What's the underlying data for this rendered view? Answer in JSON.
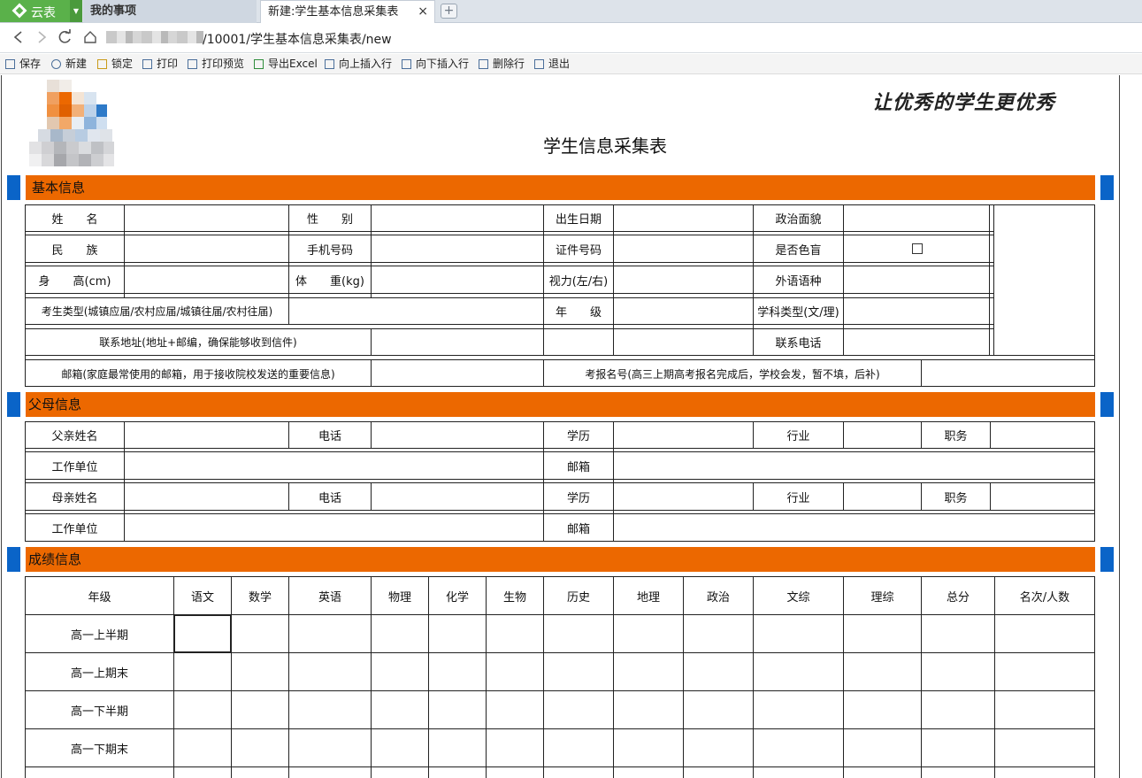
{
  "tabs": {
    "app_label": "云表",
    "tab1_label": "我的事项",
    "tab2_label": "新建:学生基本信息采集表",
    "close_glyph": "×",
    "new_tab_glyph": "+"
  },
  "address": {
    "url_visible": "/10001/学生基本信息采集表/new"
  },
  "toolbar": {
    "items": [
      {
        "label": "保存",
        "icon": "save-icon"
      },
      {
        "label": "新建",
        "icon": "new-icon"
      },
      {
        "label": "锁定",
        "icon": "lock-icon"
      },
      {
        "label": "打印",
        "icon": "print-icon"
      },
      {
        "label": "打印预览",
        "icon": "print-preview-icon"
      },
      {
        "label": "导出Excel",
        "icon": "excel-icon"
      },
      {
        "label": "向上插入行",
        "icon": "insert-row-above-icon"
      },
      {
        "label": "向下插入行",
        "icon": "insert-row-below-icon"
      },
      {
        "label": "删除行",
        "icon": "delete-row-icon"
      },
      {
        "label": "退出",
        "icon": "exit-icon"
      }
    ]
  },
  "form": {
    "slogan": "让优秀的学生更优秀",
    "title": "学生信息采集表",
    "section_basic": "基本信息",
    "section_parents": "父母信息",
    "section_scores": "成绩信息",
    "basic": {
      "name": "姓　　名",
      "gender": "性　　别",
      "birth": "出生日期",
      "politics": "政治面貌",
      "ethnic": "民　　族",
      "phone": "手机号码",
      "id_no": "证件号码",
      "colorblind": "是否色盲",
      "height": "身　　高(cm)",
      "weight": "体　　重(kg)",
      "vision": "视力(左/右)",
      "foreign_lang": "外语语种",
      "exam_type": "考生类型(城镇应届/农村应届/城镇往届/农村往届)",
      "grade": "年　　级",
      "subject_type": "学科类型(文/理)",
      "address": "联系地址(地址+邮编，确保能够收到信件)",
      "contact_phone": "联系电话",
      "email": "邮箱(家庭最常使用的邮箱，用于接收院校发送的重要信息)",
      "exam_no": "考报名号(高三上期高考报名完成后，学校会发，暂不填，后补)"
    },
    "parents": {
      "father_name": "父亲姓名",
      "mother_name": "母亲姓名",
      "phone": "电话",
      "education": "学历",
      "industry": "行业",
      "position": "职务",
      "work_unit": "工作单位",
      "email": "邮箱"
    },
    "scores": {
      "headers": [
        "年级",
        "语文",
        "数学",
        "英语",
        "物理",
        "化学",
        "生物",
        "历史",
        "地理",
        "政治",
        "文综",
        "理综",
        "总分",
        "名次/人数"
      ],
      "rows": [
        "高一上半期",
        "高一上期末",
        "高一下半期",
        "高一下期末"
      ]
    }
  },
  "colors": {
    "section_bar": "#ec6800",
    "section_marker": "#0a64c8",
    "app_green": "#5ab14a"
  }
}
